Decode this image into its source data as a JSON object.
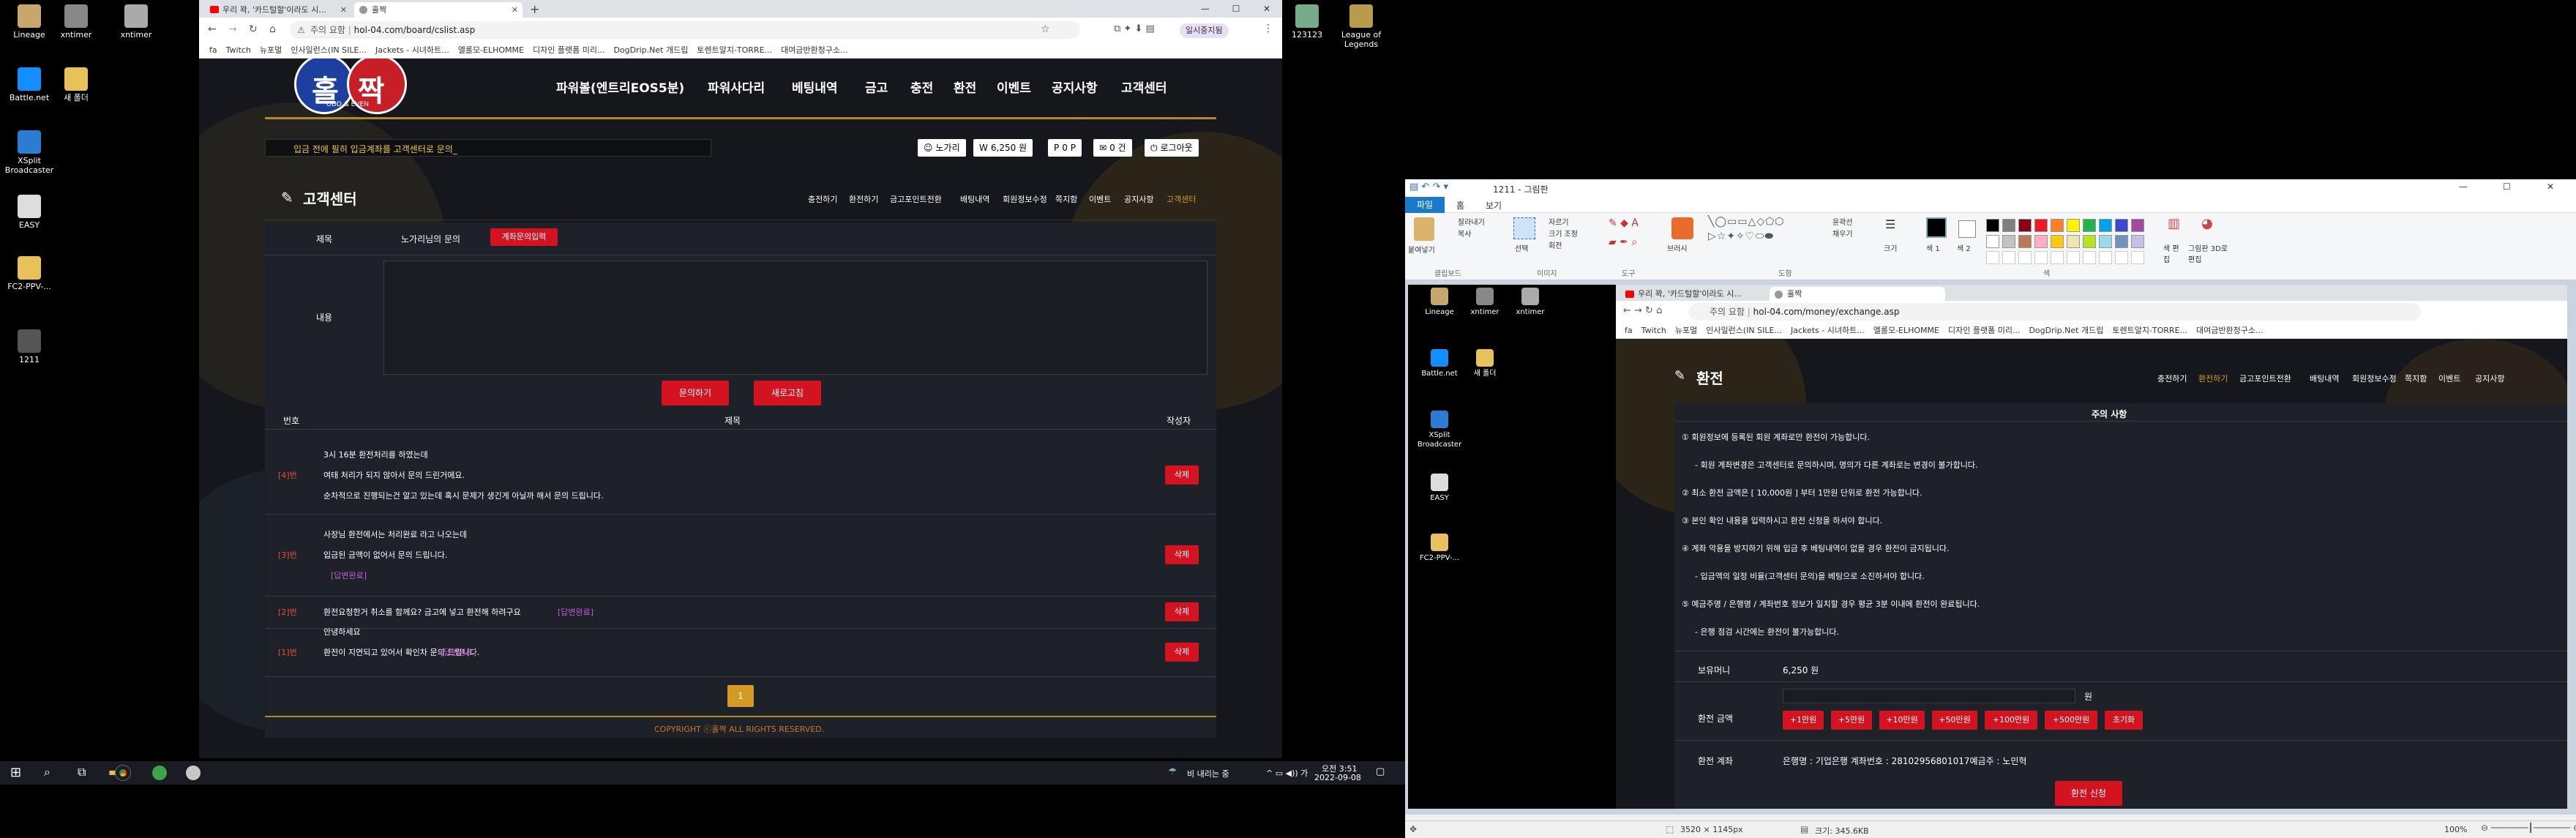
{
  "desktop_left": [
    {
      "label": "Lineage",
      "color": "#c9a66b"
    },
    {
      "label": "xntimer",
      "color": "#888"
    },
    {
      "label": "xntimer",
      "color": "#aaa"
    },
    {
      "label": "Battle.net",
      "color": "#148eff"
    },
    {
      "label": "새 폴더",
      "color": "#e8c15a"
    },
    {
      "label": "XSplit Broadcaster",
      "color": "#2b7cd3"
    },
    {
      "label": "EASY",
      "color": "#ddd"
    },
    {
      "label": "FC2-PPV-...",
      "color": "#e8c15a"
    },
    {
      "label": "1211",
      "color": "#555"
    }
  ],
  "desktop_right": [
    {
      "label": "123123",
      "color": "#7a8"
    },
    {
      "label": "League of Legends",
      "color": "#b89b4d"
    }
  ],
  "browser1": {
    "tab1": "우리 꽉, '카드털할'이라도 시...",
    "tab2": "홀짝",
    "warn": "주의 요함",
    "url": "hol-04.com/board/cslist.asp",
    "profile": "일시중지됨"
  },
  "bookmarks": [
    "fa",
    "Twitch",
    "뉴포멀",
    "인사일런스(IN SILE...",
    "Jackets - 시녀하트...",
    "엘롤모-ELHOMME",
    "디자인 플랫폼 미리...",
    "DogDrip.Net 개드립",
    "토렌트알지-TORRE...",
    "대여금반환청구소..."
  ],
  "site": {
    "logo": "홀짝",
    "logo_sub": "ODD & EVEN",
    "nav": [
      "파워볼(엔트리EOS5분)",
      "파워사다리",
      "베팅내역",
      "금고",
      "충전",
      "환전",
      "이벤트",
      "공지사항",
      "고객센터"
    ],
    "notice": "입금 전에 필히 입금계좌를 고객센터로 문의_",
    "user": {
      "name": "노가리",
      "balance": "6,250 원",
      "point": "0 P",
      "count": "0 건",
      "logout": "로그아웃"
    },
    "page_title": "고객센터",
    "subnav": [
      "충전하기",
      "환전하기",
      "금고포인트전환",
      "배팅내역",
      "회원정보수정",
      "쪽지함",
      "이벤트",
      "공지사항",
      "고객센터"
    ],
    "form": {
      "subject_label": "제목",
      "subject_value": "노가리님의 문의",
      "account_btn": "계좌문의입력",
      "content_label": "내용",
      "submit": "문의하기",
      "refresh": "새로고침"
    },
    "table": {
      "headers": [
        "번호",
        "제목",
        "작성자"
      ],
      "del": "삭제",
      "rows": [
        {
          "num": "[4]번",
          "lines": [
            "3시 16분 환전처리를 하였는데",
            "여태 처리가 되지 않아서 문의 드린거에요.",
            "순차적으로 진행되는건 알고 있는데 혹시 문제가 생긴게 아닐까 해서 문의 드립니다."
          ],
          "status": ""
        },
        {
          "num": "[3]번",
          "lines": [
            "사장님 환전에서는 처리완료 라고 나오는데",
            "입금된 금액이 없어서 문의 드립니다."
          ],
          "status": "[답변완료]"
        },
        {
          "num": "[2]번",
          "lines": [
            "환전요청한거 취소를 함께요? 금고에 넣고 환전해 하려구요"
          ],
          "status": "[답변완료]"
        },
        {
          "num": "[1]번",
          "lines": [
            "안녕하세요",
            "환전이 지연되고 있어서 확인차 문의 드립니다."
          ],
          "status": "[답변완료]"
        }
      ]
    },
    "page": "1",
    "copyright": "COPYRIGHT ⓒ홀짝 ALL RIGHTS RESERVED."
  },
  "taskbar": {
    "weather": "비 내리는 중",
    "time": "오전 3:51",
    "date": "2022-09-08"
  },
  "paint": {
    "title": "1211 - 그림판",
    "menu": [
      "파일",
      "홈",
      "보기"
    ],
    "groups": [
      "클립보드",
      "이미지",
      "도구",
      "도형",
      "색"
    ],
    "tools": {
      "paste": "붙여넣기",
      "cut": "잘라내기",
      "copy": "복사",
      "select": "선택",
      "crop": "자르기",
      "resize": "크기 조정",
      "rotate": "회전",
      "brush": "브러시",
      "outline": "윤곽선",
      "fill": "채우기",
      "size": "크기",
      "color1": "색 1",
      "color2": "색 2",
      "edit_colors": "색 편집",
      "paint3d": "그림판 3D로 편집"
    },
    "status": {
      "dims": "3520 × 1145px",
      "size": "크기: 345.6KB",
      "zoom": "100%"
    },
    "palette": [
      "#000000",
      "#7f7f7f",
      "#880015",
      "#ed1c24",
      "#ff7f27",
      "#fff200",
      "#22b14c",
      "#00a2e8",
      "#3f48cc",
      "#a349a4",
      "#ffffff",
      "#c3c3c3",
      "#b97a57",
      "#ffaec9",
      "#ffc90e",
      "#efe4b0",
      "#b5e61d",
      "#99d9ea",
      "#7092be",
      "#c8bfe7"
    ]
  },
  "inner": {
    "desktop": [
      "Lineage",
      "xntimer",
      "xntimer",
      "Battle.net",
      "새 폴더",
      "XSplit Broadcaster",
      "EASY",
      "FC2-PPV-..."
    ],
    "tab1": "우리 꽉, '카드털할'이라도 시...",
    "tab2": "홀짝",
    "url": "hol-04.com/money/exchange.asp",
    "warn": "주의 요함",
    "title": "환전",
    "balance_short": "6,250 원",
    "subnav": [
      "충전하기",
      "환전하기",
      "금고포인트전환",
      "배팅내역",
      "회원정보수정",
      "쪽지함",
      "이벤트",
      "공지사항"
    ],
    "notice_title": "주의 사항",
    "notices": [
      "① 회원정보에 등록된 회원 계좌로만 환전이 가능합니다.",
      "- 회원 계좌변경은 고객센터로 문의하시며, 명의가 다른 계좌로는 변경이 불가합니다.",
      "② 최소 환전 금액은 [ 10,000원 ] 부터 1만원 단위로 환전 가능합니다.",
      "③ 본인 확인 내용을 입력하시고 환전 신청을 하셔야 합니다.",
      "④ 계좌 악용을 방지하기 위해 입금 후 베팅내역이 없을 경우 환전이 금지됩니다.",
      "- 입금액의 일정 비율(고객센터 문의)을 베팅으로 소진하셔야 합니다.",
      "⑤ 예금주명 / 은행명 / 계좌번호 정보가 일치할 경우 평균 3분 이내에 환전이 완료됩니다.",
      "- 은행 점검 시간에는 환전이 불가능합니다."
    ],
    "money_label": "보유머니",
    "money_value": "6,250 원",
    "amount_label": "환전 금액",
    "unit": "원",
    "amount_btns": [
      "+1만원",
      "+5만원",
      "+10만원",
      "+50만원",
      "+100만원",
      "+500만원",
      "초기화"
    ],
    "account_label": "환전 계좌",
    "account_value": "은행명 : 기업은행 계좌번호 : 28102956801017예금주 : 노민혁",
    "apply": "환전 신청"
  }
}
